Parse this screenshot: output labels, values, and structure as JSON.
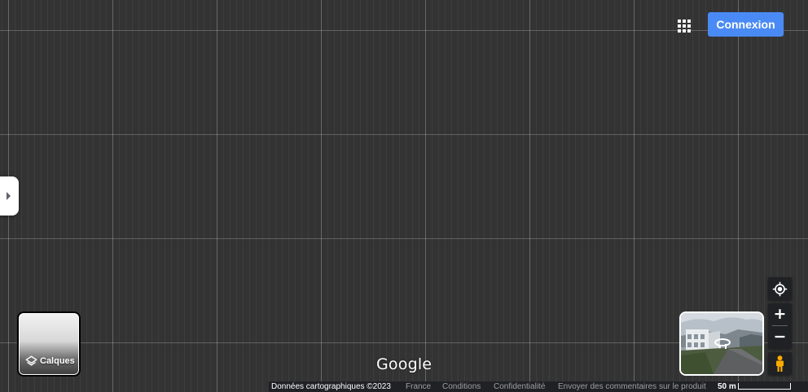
{
  "header": {
    "apps_icon": "apps-grid-icon",
    "signin_label": "Connexion"
  },
  "sidebar": {
    "toggle_icon": "chevron-right-icon"
  },
  "layers": {
    "icon": "layers-icon",
    "label": "Calques"
  },
  "branding": {
    "logo_text": "Google"
  },
  "controls": {
    "locate_icon": "my-location-icon",
    "zoom_in_label": "+",
    "zoom_out_label": "−",
    "pegman_icon": "pegman-icon",
    "streetview_icon": "rotate-360-icon"
  },
  "footer": {
    "map_data": "Données cartographiques ©2023",
    "country": "France",
    "terms": "Conditions",
    "privacy": "Confidentialité",
    "feedback": "Envoyer des commentaires sur le produit",
    "scale_label": "50 m"
  },
  "colors": {
    "map_background": "#333333",
    "signin_button": "#4a8af4",
    "control_background": "#202124",
    "pegman": "#f9ab00"
  }
}
